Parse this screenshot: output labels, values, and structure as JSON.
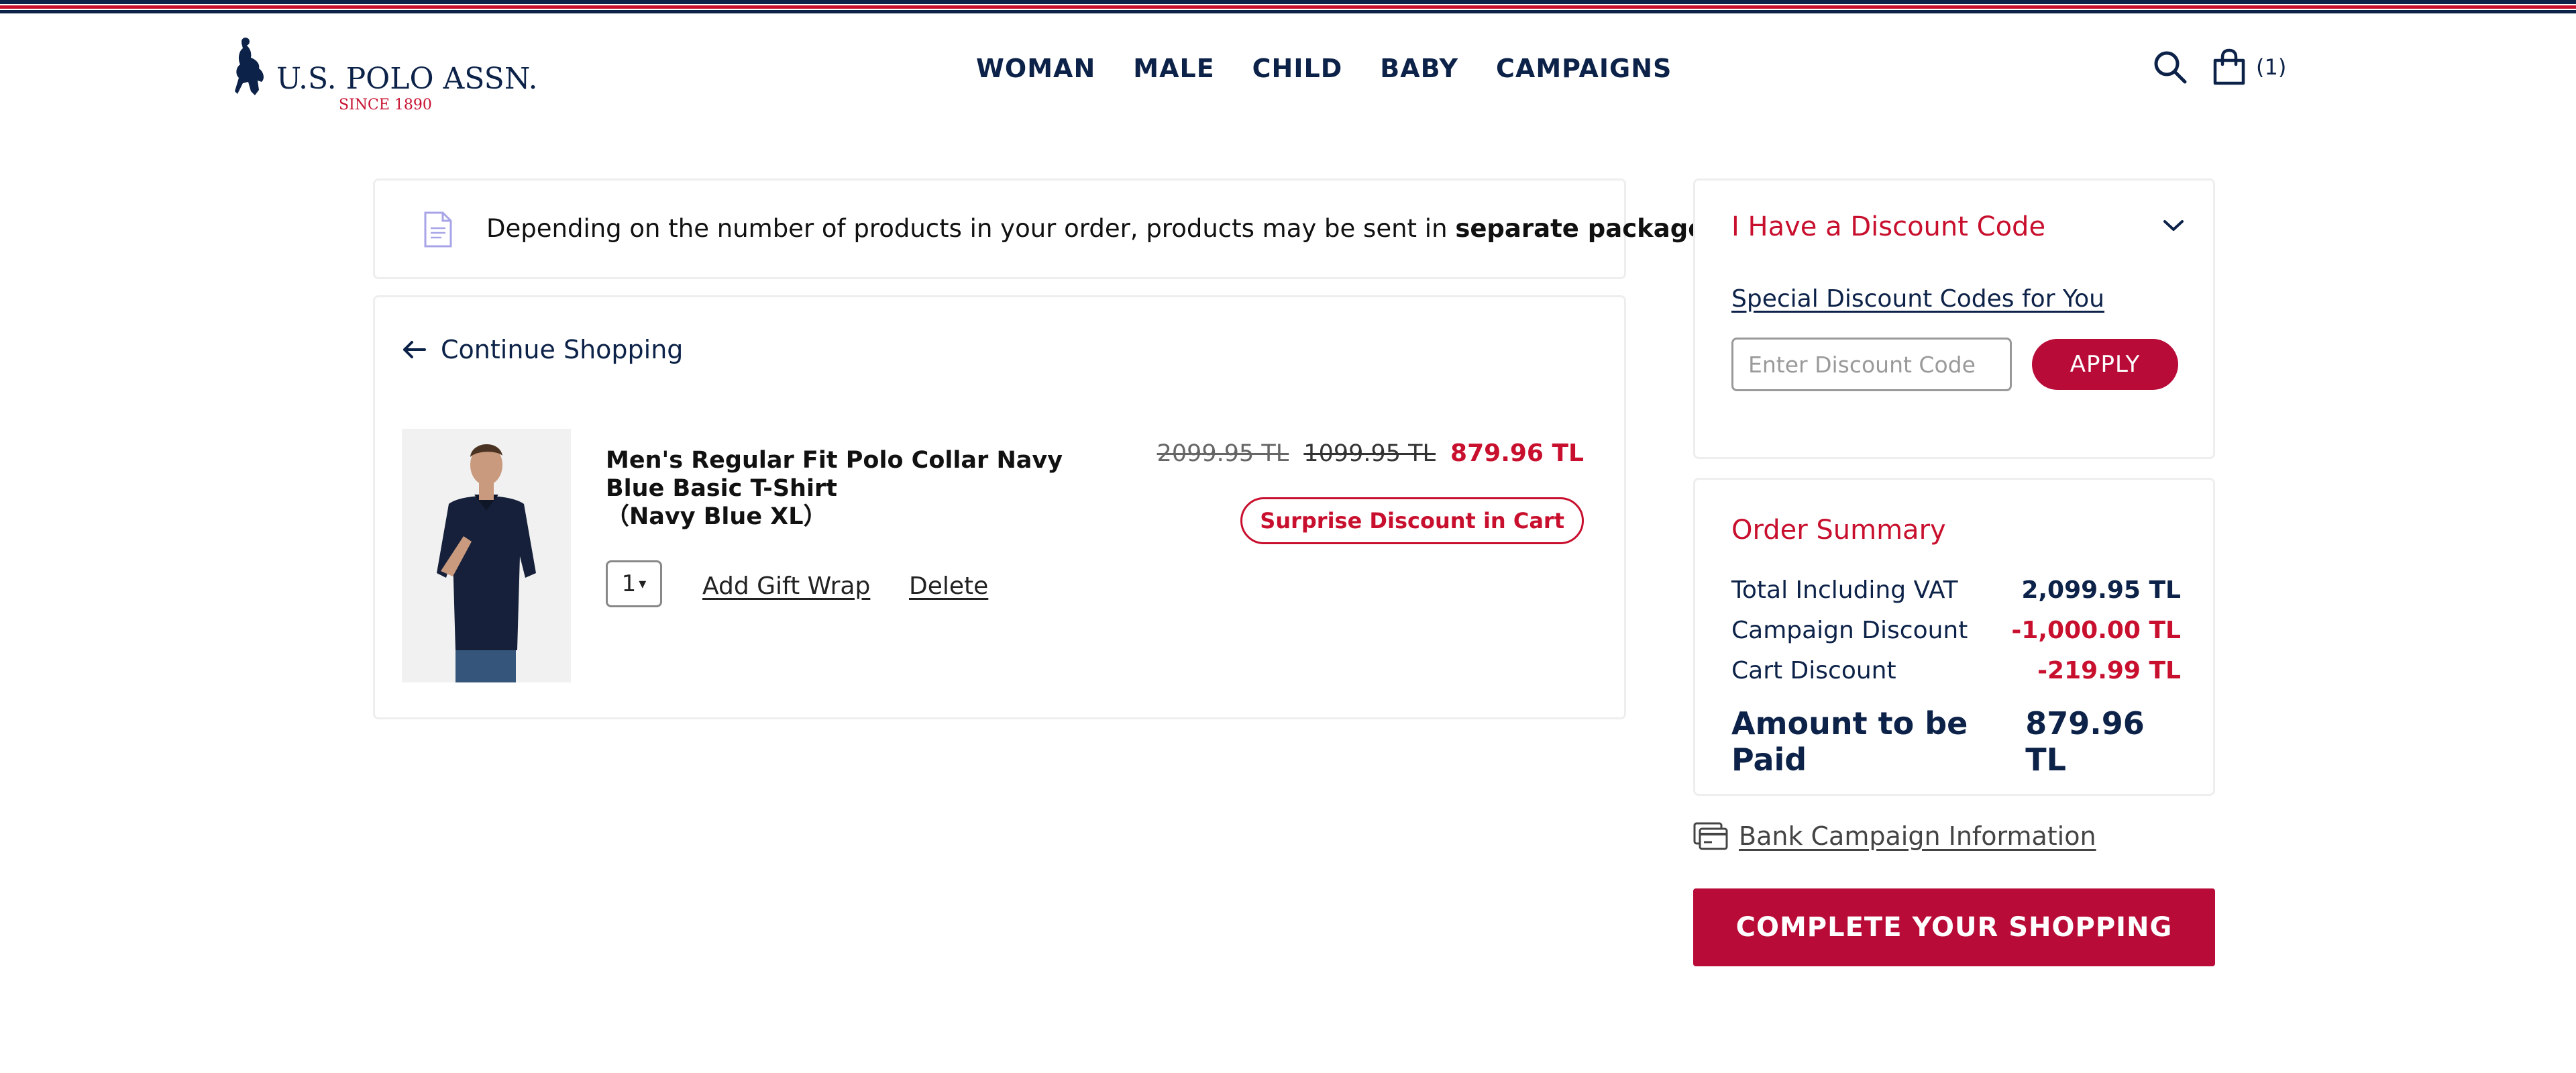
{
  "brand": {
    "name": "U.S. POLO ASSN.",
    "since": "SINCE 1890",
    "colors": {
      "navy": "#0c2248",
      "red": "#c8102e",
      "button_red": "#b80b38"
    }
  },
  "nav": {
    "items": [
      "WOMAN",
      "MALE",
      "CHILD",
      "BABY",
      "CAMPAIGNS"
    ]
  },
  "header": {
    "search_icon": "search-icon",
    "cart_icon": "shopping-bag-icon",
    "cart_count": "(1)"
  },
  "notice": {
    "text": "Depending on the number of products in your order, products may be sent in ",
    "bold": "separate packages",
    "suffix": " ."
  },
  "cart": {
    "continue_label": "Continue Shopping",
    "item": {
      "title": "Men's Regular Fit Polo Collar Navy Blue Basic T-Shirt",
      "variant": "（Navy Blue XL）",
      "qty": "1",
      "gift_wrap": "Add Gift Wrap",
      "delete": "Delete",
      "price_original": "2099.95 TL",
      "price_campaign": "1099.95 TL",
      "price_final": "879.96 TL",
      "badge": "Surprise Discount in Cart"
    }
  },
  "discount": {
    "title": "I Have a Discount Code",
    "link": "Special Discount Codes for You",
    "input_placeholder": "Enter Discount Code",
    "apply_label": "APPLY"
  },
  "summary": {
    "title": "Order Summary",
    "rows": [
      {
        "label": "Total Including VAT",
        "value": "2,099.95 TL"
      },
      {
        "label": "Campaign Discount",
        "value": "-1,000.00 TL"
      },
      {
        "label": "Cart Discount",
        "value": "-219.99 TL"
      }
    ],
    "total_label": "Amount to be Paid",
    "total_value": "879.96 TL"
  },
  "bank": {
    "label": "Bank Campaign Information"
  },
  "checkout": {
    "label": "COMPLETE YOUR SHOPPING"
  }
}
